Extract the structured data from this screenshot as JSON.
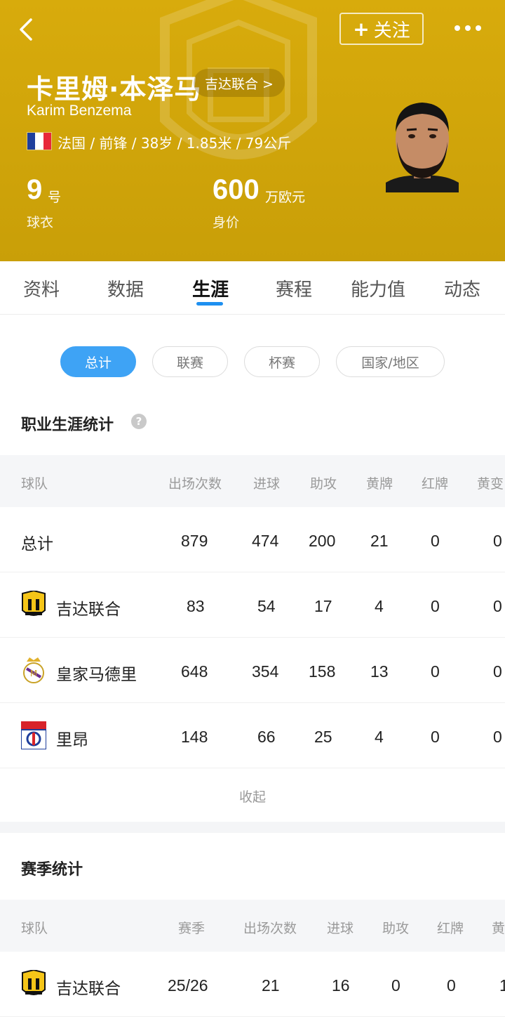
{
  "header": {
    "follow_label": "关注",
    "name_cn": "卡里姆·本泽马",
    "club_chip": "吉达联合 >",
    "name_en": "Karim Benzema",
    "meta": "法国 / 前锋 / 38岁 / 1.85米 / 79公斤",
    "flag_colors": [
      "#1f3f9c",
      "#ffffff",
      "#e8283a"
    ],
    "shirt_number": "9",
    "shirt_unit": "号",
    "shirt_caption": "球衣",
    "value_number": "600",
    "value_unit": "万欧元",
    "value_caption": "身价",
    "accent_color": "#d4a80b"
  },
  "tabs": [
    {
      "label": "资料"
    },
    {
      "label": "数据"
    },
    {
      "label": "生涯",
      "active": true
    },
    {
      "label": "赛程"
    },
    {
      "label": "能力值"
    },
    {
      "label": "动态"
    }
  ],
  "filters": [
    {
      "label": "总计",
      "active": true
    },
    {
      "label": "联赛"
    },
    {
      "label": "杯赛"
    },
    {
      "label": "国家/地区"
    }
  ],
  "career": {
    "title": "职业生涯统计",
    "help_icon": "?",
    "columns": [
      "球队",
      "出场次数",
      "进球",
      "助攻",
      "黄牌",
      "红牌",
      "黄变"
    ],
    "rows": [
      {
        "team": "总计",
        "logo": "",
        "apps": "879",
        "goals": "474",
        "assists": "200",
        "yellow": "21",
        "red": "0",
        "yr": "0"
      },
      {
        "team": "吉达联合",
        "logo": "ittihad-logo",
        "apps": "83",
        "goals": "54",
        "assists": "17",
        "yellow": "4",
        "red": "0",
        "yr": "0"
      },
      {
        "team": "皇家马德里",
        "logo": "real-madrid-logo",
        "apps": "648",
        "goals": "354",
        "assists": "158",
        "yellow": "13",
        "red": "0",
        "yr": "0"
      },
      {
        "team": "里昂",
        "logo": "lyon-logo",
        "apps": "148",
        "goals": "66",
        "assists": "25",
        "yellow": "4",
        "red": "0",
        "yr": "0"
      }
    ],
    "collapse_label": "收起"
  },
  "season": {
    "title": "赛季统计",
    "columns": [
      "球队",
      "赛季",
      "出场次数",
      "进球",
      "助攻",
      "红牌",
      "黄"
    ],
    "rows": [
      {
        "team": "吉达联合",
        "logo": "ittihad-logo",
        "season": "25/26",
        "apps": "21",
        "goals": "16",
        "assists": "0",
        "red": "0",
        "extra": "1"
      }
    ]
  }
}
